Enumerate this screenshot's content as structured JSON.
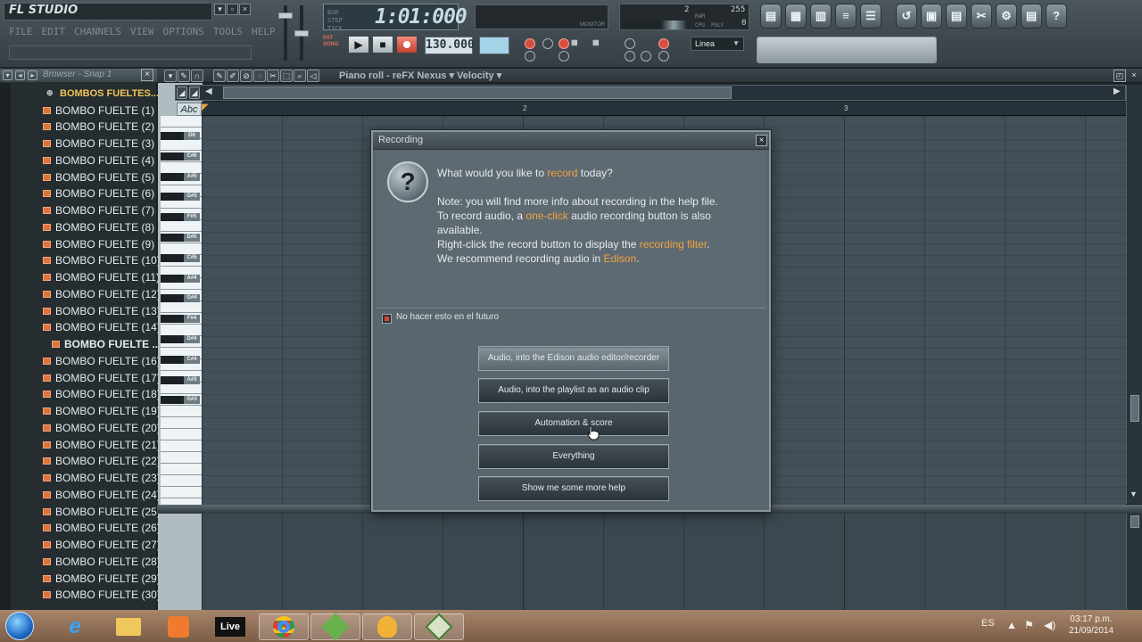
{
  "app": {
    "logo": "FL STUDIO",
    "menu": [
      "FILE",
      "EDIT",
      "CHANNELS",
      "VIEW",
      "OPTIONS",
      "TOOLS",
      "HELP"
    ]
  },
  "transport": {
    "time": "1:01:000",
    "time_tag": "BAR\nSTEP\nTICK",
    "pattern_tag": "PAT\nSONG",
    "bpm": "130.000",
    "snap": "Linea",
    "monitor_label": "MONITOR"
  },
  "cpu": {
    "voices": "2",
    "ram_label": "RAM",
    "max": "255",
    "cpu_label": "CPU",
    "poly_label": "POLY",
    "poly": "0"
  },
  "browser": {
    "title": "Browser - Snap 1",
    "folder": "BOMBOS FUELTES...",
    "items": [
      "BOMBO FUELTE (1)",
      "BOMBO FUELTE (2)",
      "BOMBO FUELTE (3)",
      "BOMBO FUELTE (4)",
      "BOMBO FUELTE (5)",
      "BOMBO FUELTE (6)",
      "BOMBO FUELTE (7)",
      "BOMBO FUELTE (8)",
      "BOMBO FUELTE (9)",
      "BOMBO FUELTE (10)",
      "BOMBO FUELTE (11)",
      "BOMBO FUELTE (12)",
      "BOMBO FUELTE (13)",
      "BOMBO FUELTE (14)",
      "BOMBO FUELTE ...",
      "BOMBO FUELTE (16)",
      "BOMBO FUELTE (17)",
      "BOMBO FUELTE (18)",
      "BOMBO FUELTE (19)",
      "BOMBO FUELTE (20)",
      "BOMBO FUELTE (21)",
      "BOMBO FUELTE (22)",
      "BOMBO FUELTE (23)",
      "BOMBO FUELTE (24)",
      "BOMBO FUELTE (25)",
      "BOMBO FUELTE (26)",
      "BOMBO FUELTE (27)",
      "BOMBO FUELTE (28)",
      "BOMBO FUELTE (29)",
      "BOMBO FUELTE (30)"
    ],
    "selected_index": 14
  },
  "piano_roll": {
    "title": "Piano roll - reFX Nexus",
    "param": "Velocity",
    "abc": "Abc",
    "ruler": [
      "2",
      "3"
    ],
    "keys": [
      "D6",
      "C#6",
      "A#5",
      "G#5",
      "F#5",
      "D#5",
      "C#5",
      "A#4",
      "G#4",
      "F#4",
      "D#4",
      "C#4",
      "A#3",
      "G#3"
    ]
  },
  "dialog": {
    "title": "Recording",
    "question_pre": "What would you like to ",
    "question_hl": "record",
    "question_post": " today?",
    "note1": "Note: you will find more info about recording in the help file.",
    "note2_pre": "To record audio, a ",
    "note2_hl": "one-click",
    "note2_post": " audio recording button is also",
    "note3": "available.",
    "note4_pre": "Right-click the record button to display the ",
    "note4_hl": "recording filter",
    "note4_post": ".",
    "note5_pre": "We recommend recording audio in ",
    "note5_hl": "Edison",
    "note5_post": ".",
    "checkbox": "No hacer esto en el futuro",
    "buttons": [
      "Audio, into the Edison audio editor/recorder",
      "Audio, into the playlist as an audio clip",
      "Automation & score",
      "Everything",
      "Show me some more help"
    ]
  },
  "taskbar": {
    "live": "Live",
    "lang": "ES",
    "time": "03:17 p.m.",
    "date": "21/09/2014"
  },
  "colors": {
    "accent_orange": "#f2a23e",
    "record_red": "#d84f3e",
    "browser_folder": "#f3c356"
  }
}
